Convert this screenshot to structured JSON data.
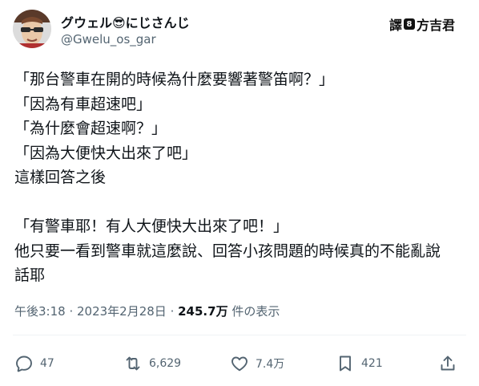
{
  "user": {
    "display_name": "グウェル😎にじさんじ",
    "handle": "@Gwelu_os_gar"
  },
  "watermark": {
    "prefix": "譯",
    "badge": "8",
    "name": "方吉君"
  },
  "tweet": {
    "lines": [
      "「那台警車在開的時候為什麼要響著警笛啊？」",
      "「因為有車超速吧」",
      "「為什麼會超速啊？」",
      "「因為大便快大出來了吧」",
      "這樣回答之後",
      "",
      "「有警車耶！有人大便快大出來了吧！」",
      "他只要一看到警車就這麼說、回答小孩問題的時候真的不能亂說",
      "話耶"
    ]
  },
  "meta": {
    "time": "午後3:18",
    "separator": " · ",
    "date": "2023年2月28日",
    "views": "245.7万",
    "views_label": " 件の表示"
  },
  "actions": {
    "replies": "47",
    "retweets": "6,629",
    "likes": "7.4万",
    "bookmarks": "421"
  },
  "icons": {
    "reply": "reply-icon",
    "retweet": "retweet-icon",
    "like": "heart-icon",
    "bookmark": "bookmark-icon",
    "share": "share-icon"
  },
  "colors": {
    "text": "#0f1419",
    "secondary": "#536471",
    "divider": "#eff3f4"
  }
}
